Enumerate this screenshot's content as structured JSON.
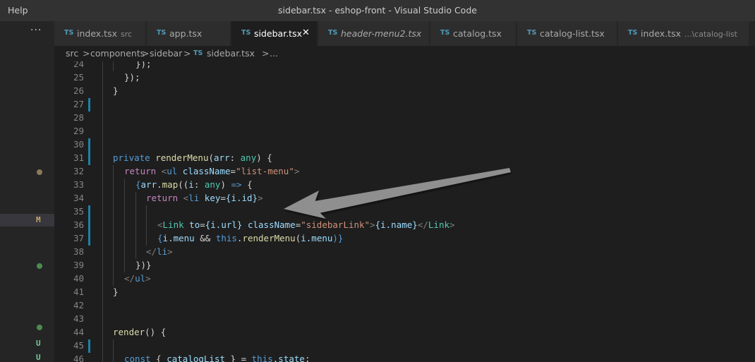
{
  "titlebar": {
    "menu_help": "Help",
    "title": "sidebar.tsx - eshop-front - Visual Studio Code"
  },
  "sidebar": {
    "ellipsis": "···"
  },
  "tabs": [
    {
      "badge": "TS",
      "name": "index.tsx",
      "desc": "src",
      "italic": false,
      "active": false
    },
    {
      "badge": "TS",
      "name": "app.tsx",
      "desc": "",
      "italic": false,
      "active": false
    },
    {
      "badge": "TS",
      "name": "sidebar.tsx",
      "desc": "",
      "italic": false,
      "active": true,
      "close": "✕"
    },
    {
      "badge": "TS",
      "name": "header-menu2.tsx",
      "desc": "",
      "italic": true,
      "active": false
    },
    {
      "badge": "TS",
      "name": "catalog.tsx",
      "desc": "",
      "italic": false,
      "active": false
    },
    {
      "badge": "TS",
      "name": "catalog-list.tsx",
      "desc": "",
      "italic": false,
      "active": false
    },
    {
      "badge": "TS",
      "name": "index.tsx",
      "desc": "...\\catalog-list",
      "italic": false,
      "active": false
    }
  ],
  "breadcrumb": {
    "parts": [
      "src",
      "components",
      "sidebar"
    ],
    "file_badge": "TS",
    "file": "sidebar.tsx",
    "separator": ">",
    "tail": "..."
  },
  "scm_markers": [
    {
      "line": "32",
      "kind": "dot",
      "color": "#8a7a5a"
    },
    {
      "line": "36",
      "kind": "badge",
      "text": "M",
      "color": "#c2a46a",
      "selected": true
    },
    {
      "line": "39",
      "kind": "dot",
      "color": "#4e8a4e"
    },
    {
      "line": "44",
      "kind": "dot",
      "color": "#4e8a4e"
    },
    {
      "line": "45",
      "kind": "badge",
      "text": "U",
      "color": "#73c991"
    },
    {
      "line": "46",
      "kind": "badge",
      "text": "U",
      "color": "#73c991"
    }
  ],
  "editor": {
    "line_numbers": [
      "24",
      "25",
      "26",
      "27",
      "28",
      "29",
      "30",
      "31",
      "32",
      "33",
      "34",
      "35",
      "36",
      "37",
      "38",
      "39",
      "40",
      "41",
      "42",
      "43",
      "44",
      "45",
      "46"
    ],
    "modified_lines": [
      "27",
      "30",
      "31",
      "35",
      "36",
      "37",
      "45"
    ],
    "lines": {
      "l24": "});",
      "l25": "});",
      "l26": "}",
      "l31": {
        "private": "private",
        "name": "renderMenu",
        "p1": "(",
        "arr": "arr",
        "colon": ": ",
        "any": "any",
        "p2": ") {"
      },
      "l32": {
        "return": "return",
        "open": " <",
        "ul": "ul",
        "cls": " className",
        "eq": "=",
        "str": "\"list-menu\"",
        "close": ">"
      },
      "l33": {
        "b": "{",
        "arr": "arr",
        "dot": ".",
        "map": "map",
        "p": "((",
        "i": "i",
        "colon": ": ",
        "any": "any",
        "p2": ") ",
        "arrow": "=>",
        "brace": " {"
      },
      "l34": {
        "return": "return",
        "open": " <",
        "li": "li",
        "key": " key",
        "eq": "=",
        "expr": "{i.id}",
        "close": ">"
      },
      "l36": {
        "open": "<",
        "link": "Link",
        "to": " to",
        "eq": "=",
        "expr": "{i.url}",
        "cls": " className",
        "eq2": "=",
        "str": "\"sidebarLink\"",
        "gt": ">",
        "name": "{i.name}",
        "endopen": "</",
        "link2": "Link",
        "endclose": ">"
      },
      "l37": {
        "b": "{",
        "i": "i",
        "dot": ".",
        "menu": "menu",
        "and": " && ",
        "this": "this",
        "dot2": ".",
        "fn": "renderMenu",
        "p": "(",
        "arg": "i.menu",
        "p2": ")}"
      },
      "l38": {
        "open": "</",
        "li": "li",
        "close": ">"
      },
      "l39": "})}",
      "l40": {
        "open": "</",
        "ul": "ul",
        "close": ">"
      },
      "l41": "}",
      "l44": {
        "name": "render",
        "rest": "() {"
      },
      "l46": {
        "const": "const",
        "b": " { ",
        "var": "catalogList",
        "b2": " } = ",
        "this": "this",
        "dot": ".",
        "state": "state",
        "semi": ";"
      }
    }
  },
  "annotation": {
    "color": "#8f8f8f",
    "shape": "arrow"
  }
}
